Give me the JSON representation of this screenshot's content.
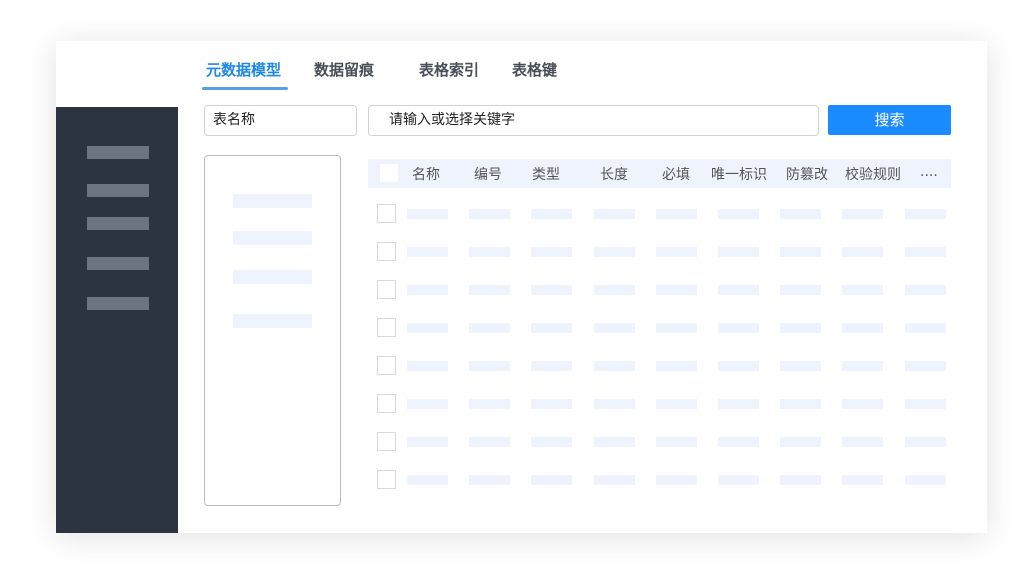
{
  "tabs": [
    "元数据模型",
    "数据留痕",
    "表格索引",
    "表格键"
  ],
  "active_tab": 0,
  "search": {
    "table_name": "表名称",
    "keyword_placeholder": "请输入或选择关键字",
    "button": "搜索"
  },
  "table": {
    "headers": [
      "名称",
      "编号",
      "类型",
      "长度",
      "必填",
      "唯一标识",
      "防篡改",
      "校验规则",
      "...."
    ],
    "placeholder_rows": 8
  },
  "colors": {
    "accent": "#1a8cff",
    "sidebar": "#2b3440",
    "placeholder": "#eef3fd"
  }
}
